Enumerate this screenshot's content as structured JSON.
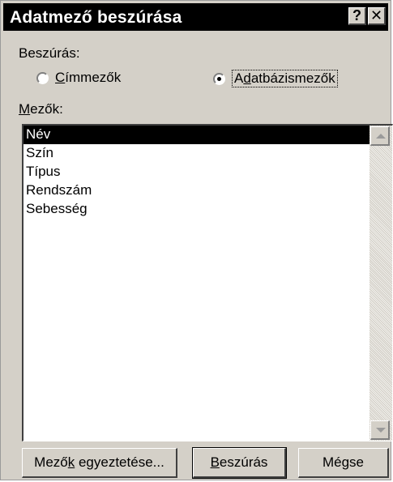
{
  "dialog": {
    "title": "Adatmező beszúrása",
    "help_label": "?",
    "close_label": "✕"
  },
  "insert_group": {
    "label": "Beszúrás:",
    "options": [
      {
        "label_pre": "",
        "label_u": "C",
        "label_post": "ímmezők",
        "checked": false
      },
      {
        "label_pre": "A",
        "label_u": "d",
        "label_post": "atbázismezők",
        "checked": true
      }
    ]
  },
  "fields": {
    "label_u": "M",
    "label_post": "ezők:",
    "items": [
      "Név",
      "Szín",
      "Típus",
      "Rendszám",
      "Sebesség"
    ],
    "selected_index": 0
  },
  "buttons": {
    "match_pre": "Mező",
    "match_u": "k",
    "match_post": " egyeztetése...",
    "insert_u": "B",
    "insert_post": "eszúrás",
    "cancel": "Mégse"
  },
  "icons": {
    "help": "help-icon",
    "close": "close-icon",
    "scroll_up": "arrow-up-icon",
    "scroll_down": "arrow-down-icon"
  }
}
